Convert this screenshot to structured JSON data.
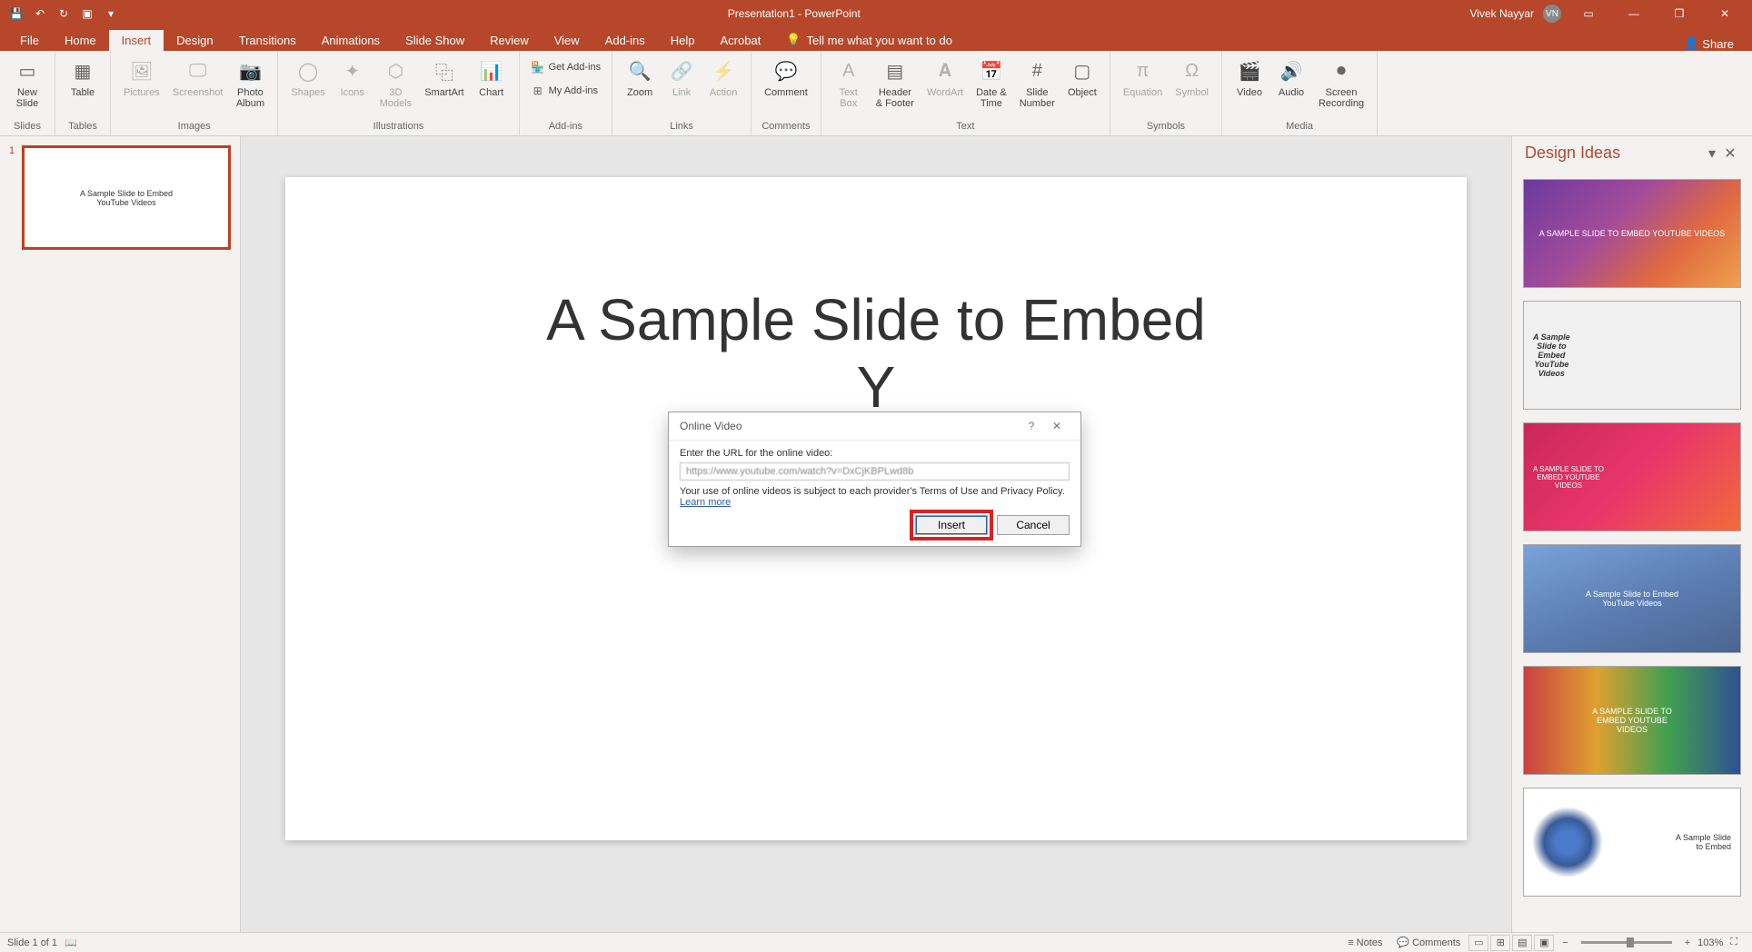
{
  "titlebar": {
    "title": "Presentation1 - PowerPoint",
    "user_name": "Vivek Nayyar",
    "user_initials": "VN"
  },
  "tabs": {
    "file": "File",
    "home": "Home",
    "insert": "Insert",
    "design": "Design",
    "transitions": "Transitions",
    "animations": "Animations",
    "slideshow": "Slide Show",
    "review": "Review",
    "view": "View",
    "addins": "Add-ins",
    "help": "Help",
    "acrobat": "Acrobat",
    "tellme": "Tell me what you want to do",
    "share": "Share"
  },
  "ribbon": {
    "slides": {
      "newslide": "New\nSlide",
      "group": "Slides"
    },
    "tables": {
      "table": "Table",
      "group": "Tables"
    },
    "images": {
      "pictures": "Pictures",
      "screenshot": "Screenshot",
      "photoalbum": "Photo\nAlbum",
      "group": "Images"
    },
    "illustrations": {
      "shapes": "Shapes",
      "icons": "Icons",
      "models": "3D\nModels",
      "smartart": "SmartArt",
      "chart": "Chart",
      "group": "Illustrations"
    },
    "addins": {
      "get": "Get Add-ins",
      "my": "My Add-ins",
      "group": "Add-ins"
    },
    "links": {
      "zoom": "Zoom",
      "link": "Link",
      "action": "Action",
      "group": "Links"
    },
    "comments": {
      "comment": "Comment",
      "group": "Comments"
    },
    "text": {
      "textbox": "Text\nBox",
      "headerfooter": "Header\n& Footer",
      "wordart": "WordArt",
      "datetime": "Date &\nTime",
      "slidenumber": "Slide\nNumber",
      "object": "Object",
      "group": "Text"
    },
    "symbols": {
      "equation": "Equation",
      "symbol": "Symbol",
      "group": "Symbols"
    },
    "media": {
      "video": "Video",
      "audio": "Audio",
      "screenrec": "Screen\nRecording",
      "group": "Media"
    }
  },
  "thumbnail": {
    "number": "1",
    "text": "A Sample Slide to Embed\nYouTube Videos"
  },
  "slide": {
    "title_line1": "A Sample Slide to Embed",
    "title_line2_partial": "Y"
  },
  "dialog": {
    "title": "Online Video",
    "prompt": "Enter the URL for the online video:",
    "url_value": "https://www.youtube.com/watch?v=DxCjKBPLwd8b",
    "terms": "Your use of online videos is subject to each provider's Terms of Use and Privacy Policy.",
    "learn_more": "Learn more",
    "insert": "Insert",
    "cancel": "Cancel"
  },
  "design_ideas": {
    "title": "Design Ideas",
    "idea1": "A SAMPLE SLIDE TO EMBED YOUTUBE VIDEOS",
    "idea2": "A Sample\nSlide to\nEmbed\nYouTube\nVideos",
    "idea3": "A SAMPLE SLIDE TO\nEMBED YOUTUBE\nVIDEOS",
    "idea4": "A Sample Slide to Embed\nYouTube Videos",
    "idea5": "A SAMPLE SLIDE TO\nEMBED YOUTUBE\nVIDEOS",
    "idea6": "A Sample Slide\nto Embed"
  },
  "statusbar": {
    "slideinfo": "Slide 1 of 1",
    "notes": "Notes",
    "comments": "Comments",
    "zoom": "103%"
  }
}
